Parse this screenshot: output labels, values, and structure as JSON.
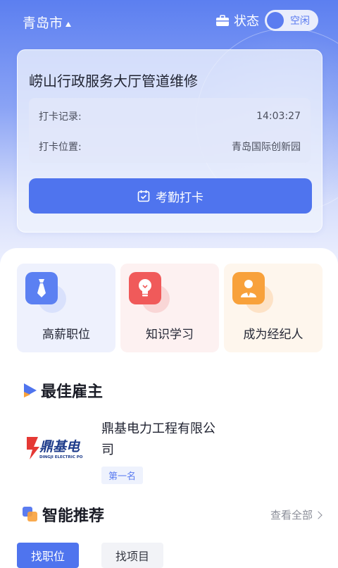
{
  "header": {
    "city": "青岛市",
    "status_label": "状态",
    "status_value": "空闲"
  },
  "attendance": {
    "title": "崂山行政服务大厅管道维修",
    "record_label": "打卡记录:",
    "record_value": "14:03:27",
    "location_label": "打卡位置:",
    "location_value": "青岛国际创新园",
    "button_label": "考勤打卡"
  },
  "features": [
    {
      "label": "高薪职位",
      "icon": "tie-icon"
    },
    {
      "label": "知识学习",
      "icon": "lightbulb-icon"
    },
    {
      "label": "成为经纪人",
      "icon": "agent-icon"
    }
  ],
  "best_employer": {
    "title": "最佳雇主",
    "company": "鼎基电力工程有限公司",
    "rank": "第一名",
    "logo_text": "鼎基电",
    "logo_subtext": "DINGJI ELECTRIC PO"
  },
  "recommend": {
    "title": "智能推荐",
    "view_all": "查看全部",
    "tabs": [
      "找职位",
      "找项目"
    ]
  },
  "colors": {
    "primary": "#4f74ee",
    "red": "#f05a5a",
    "orange": "#f8a13b"
  }
}
